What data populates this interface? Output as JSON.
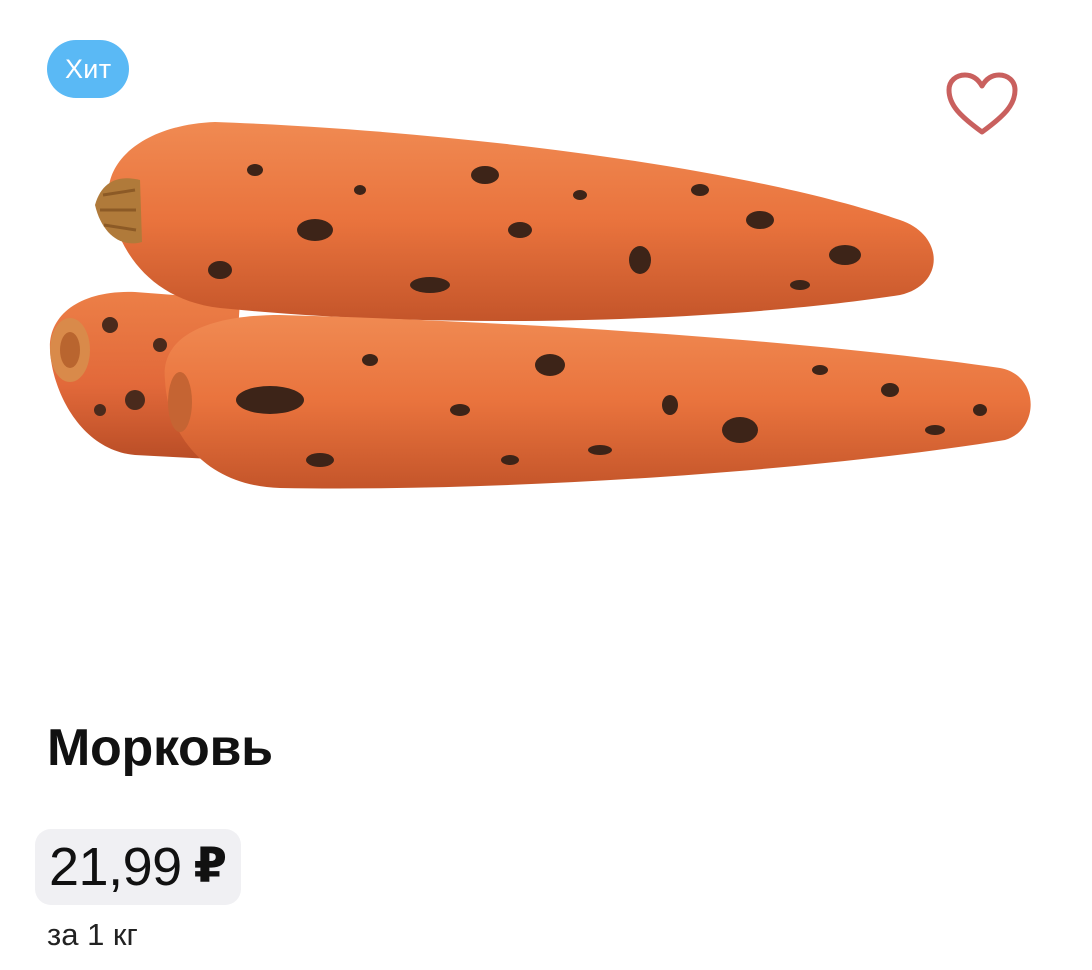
{
  "product": {
    "badge": "Хит",
    "title": "Морковь",
    "price": "21,99",
    "currency": "₽",
    "unit": "за 1 кг",
    "image": "carrots-photo"
  },
  "icons": {
    "favorite": "heart-outline-icon"
  },
  "colors": {
    "badge_bg": "#5ab9f5",
    "heart_stroke": "#c9605e",
    "price_bg": "#f0f0f3",
    "carrot": "#e9733d"
  }
}
